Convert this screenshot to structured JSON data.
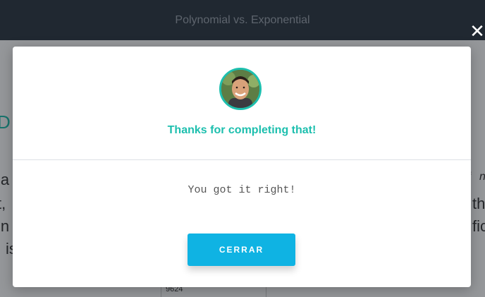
{
  "header": {
    "title": "Polynomial vs. Exponential"
  },
  "background": {
    "fragments": [
      "D",
      "ia",
      "t,",
      "in",
      "is",
      "f",
      "n",
      "th",
      "fic",
      "9624"
    ]
  },
  "modal": {
    "close_icon": "close-icon",
    "avatar_icon": "instructor-avatar",
    "title": "Thanks for completing that!",
    "message": "You got it right!",
    "button_label": "CERRAR"
  },
  "colors": {
    "accent": "#1dbfae",
    "button": "#0fb3e3",
    "header_bg": "#2b3540"
  }
}
